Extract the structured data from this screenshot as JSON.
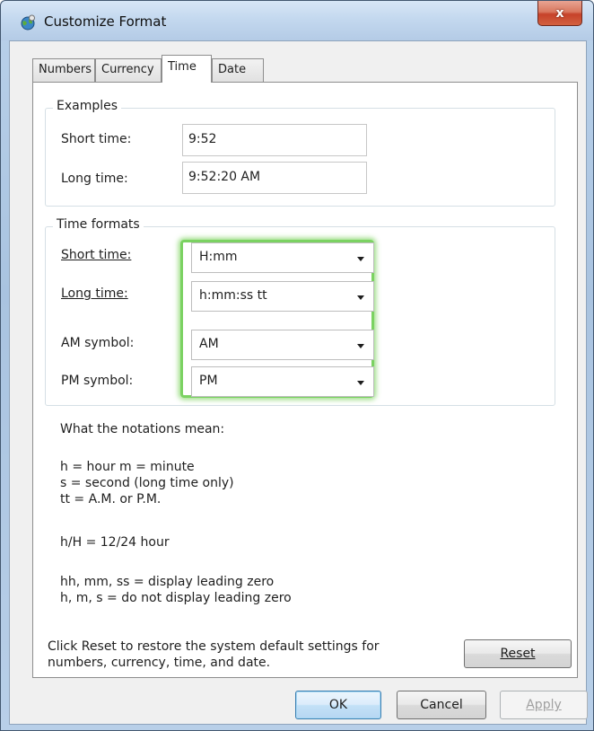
{
  "window": {
    "title": "Customize Format",
    "close_glyph": "x"
  },
  "tabs": [
    {
      "label": "Numbers",
      "active": false
    },
    {
      "label": "Currency",
      "active": false
    },
    {
      "label": "Time",
      "active": true
    },
    {
      "label": "Date",
      "active": false
    }
  ],
  "examples": {
    "title": "Examples",
    "short_time_label": "Short time:",
    "short_time_value": "9:52",
    "long_time_label": "Long time:",
    "long_time_value": "9:52:20 AM"
  },
  "time_formats": {
    "title": "Time formats",
    "short_time": {
      "label": "Short time:",
      "value": "H:mm"
    },
    "long_time": {
      "label": "Long time:",
      "value": "h:mm:ss tt"
    },
    "am_symbol": {
      "label": "AM symbol:",
      "value": "AM"
    },
    "pm_symbol": {
      "label": "PM symbol:",
      "value": "PM"
    }
  },
  "notations": {
    "heading": "What the notations mean:",
    "line1": "h = hour   m = minute",
    "line2": "s = second (long time only)",
    "line3": "tt = A.M. or P.M.",
    "line4": "h/H = 12/24 hour",
    "line5": "hh, mm, ss = display leading zero",
    "line6": "h, m, s = do not display leading zero"
  },
  "reset": {
    "text_line1": "Click Reset to restore the system default settings for",
    "text_line2": "numbers, currency, time, and date.",
    "button_label": "Reset"
  },
  "buttons": {
    "ok": "OK",
    "cancel": "Cancel",
    "apply": "Apply"
  },
  "colors": {
    "highlight_glow": "#7bd262",
    "close_button": "#c6422a"
  },
  "icons": {
    "app": "globe-settings-icon",
    "close": "close-icon",
    "dropdown": "chevron-down-icon"
  }
}
